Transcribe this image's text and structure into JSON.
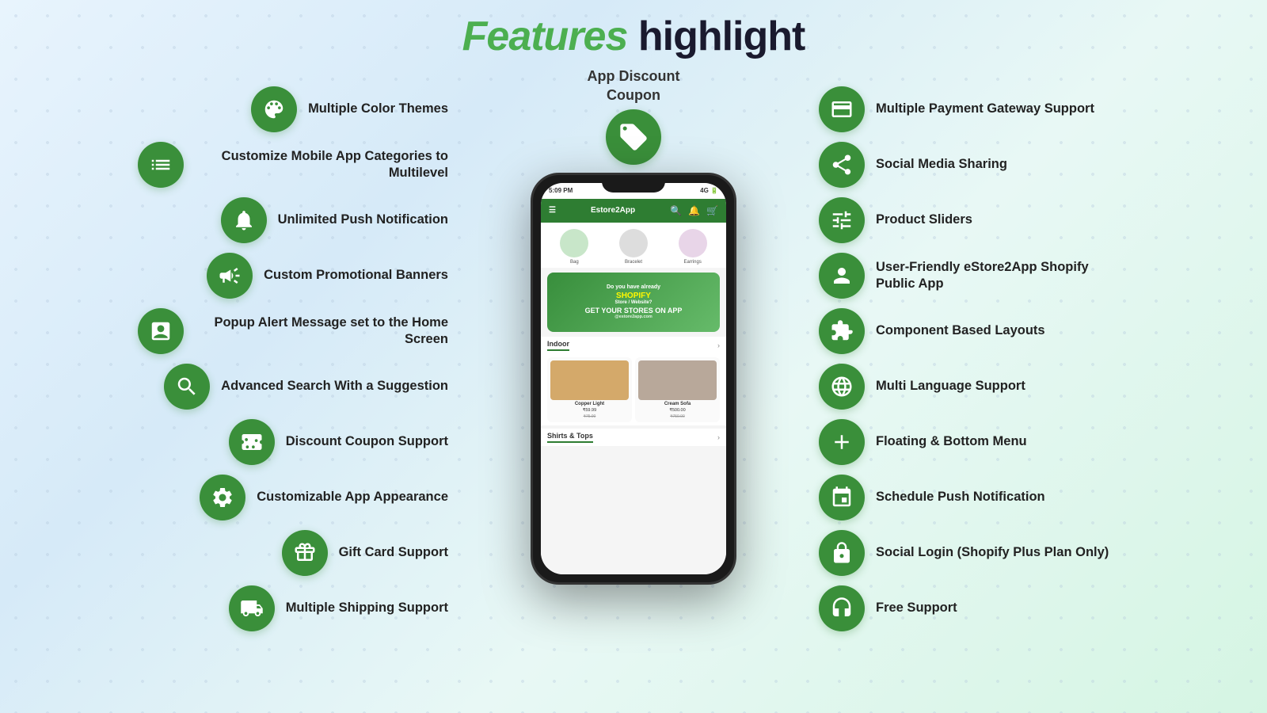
{
  "title": {
    "highlight": "Features",
    "normal": " highlight"
  },
  "center": {
    "discount_label": "App Discount\nCoupon"
  },
  "left_features": [
    {
      "id": "multiple-color-themes",
      "label": "Multiple Color Themes",
      "icon": "palette"
    },
    {
      "id": "customize-categories",
      "label": "Customize Mobile App Categories to Multilevel",
      "icon": "list"
    },
    {
      "id": "unlimited-push",
      "label": "Unlimited Push Notification",
      "icon": "bell"
    },
    {
      "id": "custom-banners",
      "label": "Custom Promotional Banners",
      "icon": "megaphone"
    },
    {
      "id": "popup-alert",
      "label": "Popup Alert Message set to the Home Screen",
      "icon": "popup"
    },
    {
      "id": "advanced-search",
      "label": "Advanced Search With a Suggestion",
      "icon": "search"
    },
    {
      "id": "discount-coupon",
      "label": "Discount Coupon Support",
      "icon": "coupon"
    },
    {
      "id": "customizable-appearance",
      "label": "Customizable App Appearance",
      "icon": "settings"
    },
    {
      "id": "gift-card",
      "label": "Gift Card Support",
      "icon": "gift"
    },
    {
      "id": "multiple-shipping",
      "label": "Multiple Shipping Support",
      "icon": "truck"
    }
  ],
  "right_features": [
    {
      "id": "multiple-payment",
      "label": "Multiple Payment Gateway Support",
      "icon": "payment"
    },
    {
      "id": "social-media",
      "label": "Social Media Sharing",
      "icon": "share"
    },
    {
      "id": "product-sliders",
      "label": "Product Sliders",
      "icon": "sliders"
    },
    {
      "id": "user-friendly",
      "label": "User-Friendly eStore2App Shopify Public App",
      "icon": "user"
    },
    {
      "id": "component-layouts",
      "label": "Component Based Layouts",
      "icon": "puzzle"
    },
    {
      "id": "multi-language",
      "label": "Multi Language Support",
      "icon": "language"
    },
    {
      "id": "floating-menu",
      "label": "Floating & Bottom Menu",
      "icon": "plus"
    },
    {
      "id": "schedule-push",
      "label": "Schedule Push Notification",
      "icon": "schedule"
    },
    {
      "id": "social-login",
      "label": "Social Login (Shopify Plus Plan Only)",
      "icon": "social-login"
    },
    {
      "id": "free-support",
      "label": "Free Support",
      "icon": "headset"
    }
  ],
  "phone": {
    "time": "5:09 PM",
    "signal": "4G",
    "app_name": "Estore2App",
    "categories": [
      "Bag",
      "Bracelet",
      "Earrings"
    ],
    "banner_text": "Do you have already SHOPIFY Store / Website? GET YOUR STORES ON APP @estore2app.com",
    "section1": "Indoor",
    "products": [
      {
        "name": "Copper Light",
        "price": "₹59.99",
        "old_price": "₹75.00"
      },
      {
        "name": "Cream Sofa",
        "price": "₹500.00",
        "old_price": "₹750.00"
      }
    ],
    "section2": "Shirts & Tops"
  }
}
